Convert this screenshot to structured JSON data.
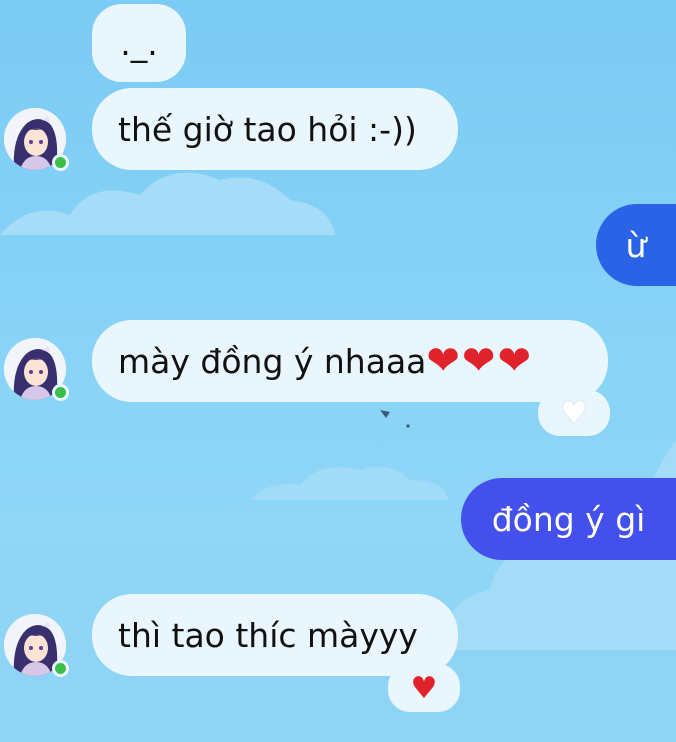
{
  "messages": {
    "m1": {
      "text": "._."
    },
    "m2": {
      "text": "thế giờ tao hỏi :-))"
    },
    "m3": {
      "text": "ừ"
    },
    "m4": {
      "text": "mày đồng ý nhaaa",
      "hearts": "❤❤❤",
      "reaction": "♥"
    },
    "m5": {
      "text": "đồng ý gì"
    },
    "m6": {
      "text": "thì tao thíc màyyy",
      "reaction": "♥"
    }
  },
  "colors": {
    "incoming_bubble": "#eaf6fd",
    "outgoing_blue": "#2a63e6",
    "outgoing_indigo": "#4450ec",
    "online": "#3bbf4a"
  },
  "icons": {
    "avatar": "anime-girl-avatar",
    "heart": "heart-icon",
    "online": "online-dot"
  }
}
